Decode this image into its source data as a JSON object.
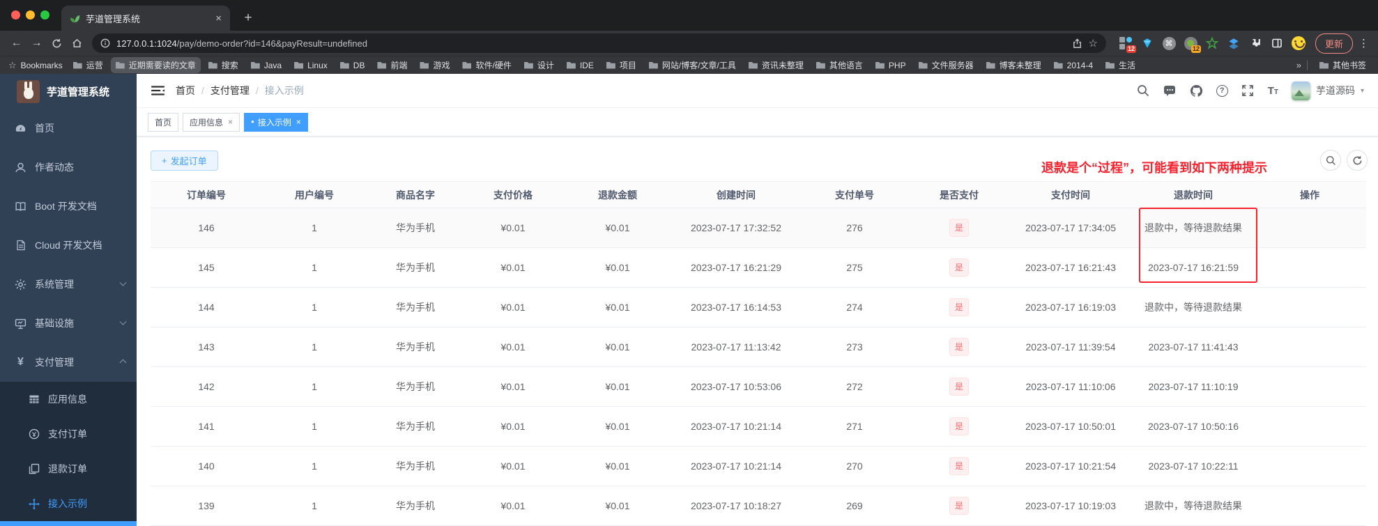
{
  "colors": {
    "accent": "#409eff",
    "annotation_red": "#f5222d",
    "paid_badge_red": "#f56c6c",
    "active_menu_blue": "#409eff"
  },
  "icons": {
    "close": "×",
    "plus": "+",
    "back": "←",
    "forward": "→",
    "more": "⋮",
    "star": "☆",
    "cmd": "⌘",
    "caret": "▾",
    "dot": "●",
    "help": "?"
  },
  "browser": {
    "tab_title": "芋道管理系统",
    "url_host": "127.0.0.1:1024",
    "url_path": "/pay/demo-order?id=146&payResult=undefined",
    "ext_badge_grid": "12",
    "ext_badge_green": "12",
    "update_button": "更新",
    "bookmarks_label": "Bookmarks",
    "bookmarks": [
      {
        "label": "运营"
      },
      {
        "label": "近期需要读的文章",
        "highlight": true
      },
      {
        "label": "搜索"
      },
      {
        "label": "Java"
      },
      {
        "label": "Linux"
      },
      {
        "label": "DB"
      },
      {
        "label": "前端"
      },
      {
        "label": "游戏"
      },
      {
        "label": "软件/硬件"
      },
      {
        "label": "设计"
      },
      {
        "label": "IDE"
      },
      {
        "label": "项目"
      },
      {
        "label": "网站/博客/文章/工具"
      },
      {
        "label": "资讯未整理"
      },
      {
        "label": "其他语言"
      },
      {
        "label": "PHP"
      },
      {
        "label": "文件服务器"
      },
      {
        "label": "博客未整理"
      },
      {
        "label": "2014-4"
      },
      {
        "label": "生活"
      }
    ],
    "overflow_chevron": "»",
    "other_bookmarks": "其他书签"
  },
  "app": {
    "logo_title": "芋道管理系统",
    "breadcrumb": [
      "首页",
      "支付管理",
      "接入示例"
    ],
    "header_user": "芋道源码",
    "sidebar_items": [
      {
        "label": "首页",
        "icon": "dashboard"
      },
      {
        "label": "作者动态",
        "icon": "user"
      },
      {
        "label": "Boot 开发文档",
        "icon": "book"
      },
      {
        "label": "Cloud 开发文档",
        "icon": "doc"
      },
      {
        "label": "系统管理",
        "icon": "gear",
        "chevron": "down"
      },
      {
        "label": "基础设施",
        "icon": "monitor",
        "chevron": "down"
      },
      {
        "label": "支付管理",
        "icon": "yen",
        "chevron": "up"
      }
    ],
    "sidebar_sub_items": [
      {
        "label": "应用信息",
        "icon": "grid"
      },
      {
        "label": "支付订单",
        "icon": "pay"
      },
      {
        "label": "退款订单",
        "icon": "refund"
      },
      {
        "label": "接入示例",
        "icon": "move",
        "active": true
      }
    ],
    "tags": [
      {
        "label": "首页",
        "closable": false,
        "active": false
      },
      {
        "label": "应用信息",
        "closable": true,
        "active": false
      },
      {
        "label": "接入示例",
        "closable": true,
        "active": true
      }
    ],
    "create_button": "发起订单",
    "annotation": "退款是个“过程”，可能看到如下两种提示",
    "table": {
      "headers": [
        "订单编号",
        "用户编号",
        "商品名字",
        "支付价格",
        "退款金额",
        "创建时间",
        "支付单号",
        "是否支付",
        "支付时间",
        "退款时间",
        "操作"
      ],
      "rows": [
        [
          "146",
          "1",
          "华为手机",
          "¥0.01",
          "¥0.01",
          "2023-07-17 17:32:52",
          "276",
          "是",
          "2023-07-17 17:34:05",
          "退款中，等待退款结果",
          ""
        ],
        [
          "145",
          "1",
          "华为手机",
          "¥0.01",
          "¥0.01",
          "2023-07-17 16:21:29",
          "275",
          "是",
          "2023-07-17 16:21:43",
          "2023-07-17 16:21:59",
          ""
        ],
        [
          "144",
          "1",
          "华为手机",
          "¥0.01",
          "¥0.01",
          "2023-07-17 16:14:53",
          "274",
          "是",
          "2023-07-17 16:19:03",
          "退款中，等待退款结果",
          ""
        ],
        [
          "143",
          "1",
          "华为手机",
          "¥0.01",
          "¥0.01",
          "2023-07-17 11:13:42",
          "273",
          "是",
          "2023-07-17 11:39:54",
          "2023-07-17 11:41:43",
          ""
        ],
        [
          "142",
          "1",
          "华为手机",
          "¥0.01",
          "¥0.01",
          "2023-07-17 10:53:06",
          "272",
          "是",
          "2023-07-17 11:10:06",
          "2023-07-17 11:10:19",
          ""
        ],
        [
          "141",
          "1",
          "华为手机",
          "¥0.01",
          "¥0.01",
          "2023-07-17 10:21:14",
          "271",
          "是",
          "2023-07-17 10:50:01",
          "2023-07-17 10:50:16",
          ""
        ],
        [
          "140",
          "1",
          "华为手机",
          "¥0.01",
          "¥0.01",
          "2023-07-17 10:21:14",
          "270",
          "是",
          "2023-07-17 10:21:54",
          "2023-07-17 10:22:11",
          ""
        ],
        [
          "139",
          "1",
          "华为手机",
          "¥0.01",
          "¥0.01",
          "2023-07-17 10:18:27",
          "269",
          "是",
          "2023-07-17 10:19:03",
          "退款中，等待退款结果",
          ""
        ]
      ]
    }
  }
}
